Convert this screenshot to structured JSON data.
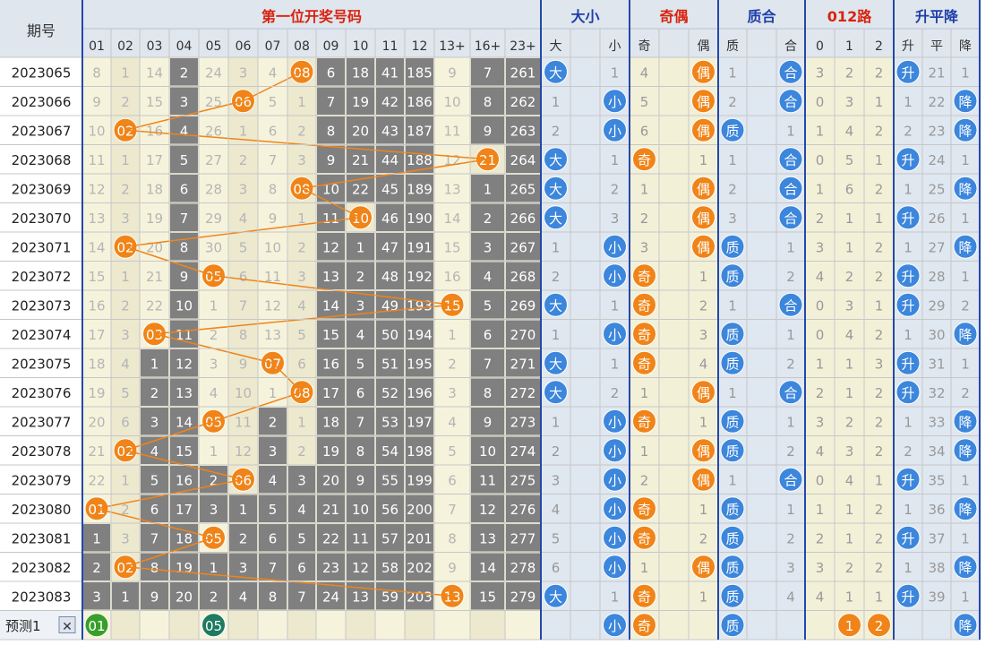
{
  "chart_data": {
    "type": "table",
    "header": {
      "period": "期号",
      "groups": [
        "第一位开奖号码",
        "大小",
        "奇偶",
        "质合",
        "012路",
        "升平降"
      ],
      "number_cols": [
        "01",
        "02",
        "03",
        "04",
        "05",
        "06",
        "07",
        "08",
        "09",
        "10",
        "11",
        "12",
        "13+",
        "16+",
        "23+"
      ],
      "bigsmall_cols": [
        "大",
        "小"
      ],
      "oddeven_cols": [
        "奇",
        "偶"
      ],
      "primecomp_cols": [
        "质",
        "合"
      ],
      "road_cols": [
        "0",
        "1",
        "2"
      ],
      "trend_cols": [
        "升",
        "平",
        "降"
      ]
    },
    "rows": [
      {
        "period": "2023065",
        "miss": [
          "8",
          "1",
          "14",
          "2",
          "24",
          "3",
          "4",
          "08",
          "6",
          "18",
          "41",
          "185",
          "9",
          "7",
          "261"
        ],
        "hit": 7,
        "bs": [
          "大",
          "1"
        ],
        "oe": [
          "4",
          "偶"
        ],
        "pc": [
          "1",
          "合"
        ],
        "road": [
          "3",
          "2",
          "2"
        ],
        "trend": [
          "升",
          "21",
          "1"
        ]
      },
      {
        "period": "2023066",
        "miss": [
          "9",
          "2",
          "15",
          "3",
          "25",
          "06",
          "5",
          "1",
          "7",
          "19",
          "42",
          "186",
          "10",
          "8",
          "262"
        ],
        "hit": 5,
        "bs": [
          "1",
          "小"
        ],
        "oe": [
          "5",
          "偶"
        ],
        "pc": [
          "2",
          "合"
        ],
        "road": [
          "0",
          "3",
          "1"
        ],
        "trend": [
          "1",
          "22",
          "降"
        ]
      },
      {
        "period": "2023067",
        "miss": [
          "10",
          "02",
          "16",
          "4",
          "26",
          "1",
          "6",
          "2",
          "8",
          "20",
          "43",
          "187",
          "11",
          "9",
          "263"
        ],
        "hit": 1,
        "bs": [
          "2",
          "小"
        ],
        "oe": [
          "6",
          "偶"
        ],
        "pc": [
          "质",
          "1"
        ],
        "road": [
          "1",
          "4",
          "2"
        ],
        "trend": [
          "2",
          "23",
          "降"
        ]
      },
      {
        "period": "2023068",
        "miss": [
          "11",
          "1",
          "17",
          "5",
          "27",
          "2",
          "7",
          "3",
          "9",
          "21",
          "44",
          "188",
          "12",
          "21",
          "264"
        ],
        "hit": 13,
        "bs": [
          "大",
          "1"
        ],
        "oe": [
          "奇",
          "1"
        ],
        "pc": [
          "1",
          "合"
        ],
        "road": [
          "0",
          "5",
          "1"
        ],
        "trend": [
          "升",
          "24",
          "1"
        ]
      },
      {
        "period": "2023069",
        "miss": [
          "12",
          "2",
          "18",
          "6",
          "28",
          "3",
          "8",
          "08",
          "10",
          "22",
          "45",
          "189",
          "13",
          "1",
          "265"
        ],
        "hit": 7,
        "bs": [
          "大",
          "2"
        ],
        "oe": [
          "1",
          "偶"
        ],
        "pc": [
          "2",
          "合"
        ],
        "road": [
          "1",
          "6",
          "2"
        ],
        "trend": [
          "1",
          "25",
          "降"
        ]
      },
      {
        "period": "2023070",
        "miss": [
          "13",
          "3",
          "19",
          "7",
          "29",
          "4",
          "9",
          "1",
          "11",
          "10",
          "46",
          "190",
          "14",
          "2",
          "266"
        ],
        "hit": 9,
        "bs": [
          "大",
          "3"
        ],
        "oe": [
          "2",
          "偶"
        ],
        "pc": [
          "3",
          "合"
        ],
        "road": [
          "2",
          "1",
          "1"
        ],
        "trend": [
          "升",
          "26",
          "1"
        ]
      },
      {
        "period": "2023071",
        "miss": [
          "14",
          "02",
          "20",
          "8",
          "30",
          "5",
          "10",
          "2",
          "12",
          "1",
          "47",
          "191",
          "15",
          "3",
          "267"
        ],
        "hit": 1,
        "bs": [
          "1",
          "小"
        ],
        "oe": [
          "3",
          "偶"
        ],
        "pc": [
          "质",
          "1"
        ],
        "road": [
          "3",
          "1",
          "2"
        ],
        "trend": [
          "1",
          "27",
          "降"
        ]
      },
      {
        "period": "2023072",
        "miss": [
          "15",
          "1",
          "21",
          "9",
          "05",
          "6",
          "11",
          "3",
          "13",
          "2",
          "48",
          "192",
          "16",
          "4",
          "268"
        ],
        "hit": 4,
        "bs": [
          "2",
          "小"
        ],
        "oe": [
          "奇",
          "1"
        ],
        "pc": [
          "质",
          "2"
        ],
        "road": [
          "4",
          "2",
          "2"
        ],
        "trend": [
          "升",
          "28",
          "1"
        ]
      },
      {
        "period": "2023073",
        "miss": [
          "16",
          "2",
          "22",
          "10",
          "1",
          "7",
          "12",
          "4",
          "14",
          "3",
          "49",
          "193",
          "15",
          "5",
          "269"
        ],
        "hit": 12,
        "bs": [
          "大",
          "1"
        ],
        "oe": [
          "奇",
          "2"
        ],
        "pc": [
          "1",
          "合"
        ],
        "road": [
          "0",
          "3",
          "1"
        ],
        "trend": [
          "升",
          "29",
          "2"
        ]
      },
      {
        "period": "2023074",
        "miss": [
          "17",
          "3",
          "03",
          "11",
          "2",
          "8",
          "13",
          "5",
          "15",
          "4",
          "50",
          "194",
          "1",
          "6",
          "270"
        ],
        "hit": 2,
        "bs": [
          "1",
          "小"
        ],
        "oe": [
          "奇",
          "3"
        ],
        "pc": [
          "质",
          "1"
        ],
        "road": [
          "0",
          "4",
          "2"
        ],
        "trend": [
          "1",
          "30",
          "降"
        ]
      },
      {
        "period": "2023075",
        "miss": [
          "18",
          "4",
          "1",
          "12",
          "3",
          "9",
          "07",
          "6",
          "16",
          "5",
          "51",
          "195",
          "2",
          "7",
          "271"
        ],
        "hit": 6,
        "bs": [
          "大",
          "1"
        ],
        "oe": [
          "奇",
          "4"
        ],
        "pc": [
          "质",
          "2"
        ],
        "road": [
          "1",
          "1",
          "3"
        ],
        "trend": [
          "升",
          "31",
          "1"
        ]
      },
      {
        "period": "2023076",
        "miss": [
          "19",
          "5",
          "2",
          "13",
          "4",
          "10",
          "1",
          "08",
          "17",
          "6",
          "52",
          "196",
          "3",
          "8",
          "272"
        ],
        "hit": 7,
        "bs": [
          "大",
          "2"
        ],
        "oe": [
          "1",
          "偶"
        ],
        "pc": [
          "1",
          "合"
        ],
        "road": [
          "2",
          "1",
          "2"
        ],
        "trend": [
          "升",
          "32",
          "2"
        ]
      },
      {
        "period": "2023077",
        "miss": [
          "20",
          "6",
          "3",
          "14",
          "05",
          "11",
          "2",
          "1",
          "18",
          "7",
          "53",
          "197",
          "4",
          "9",
          "273"
        ],
        "hit": 4,
        "bs": [
          "1",
          "小"
        ],
        "oe": [
          "奇",
          "1"
        ],
        "pc": [
          "质",
          "1"
        ],
        "road": [
          "3",
          "2",
          "2"
        ],
        "trend": [
          "1",
          "33",
          "降"
        ]
      },
      {
        "period": "2023078",
        "miss": [
          "21",
          "02",
          "4",
          "15",
          "1",
          "12",
          "3",
          "2",
          "19",
          "8",
          "54",
          "198",
          "5",
          "10",
          "274"
        ],
        "hit": 1,
        "bs": [
          "2",
          "小"
        ],
        "oe": [
          "1",
          "偶"
        ],
        "pc": [
          "质",
          "2"
        ],
        "road": [
          "4",
          "3",
          "2"
        ],
        "trend": [
          "2",
          "34",
          "降"
        ]
      },
      {
        "period": "2023079",
        "miss": [
          "22",
          "1",
          "5",
          "16",
          "2",
          "06",
          "4",
          "3",
          "20",
          "9",
          "55",
          "199",
          "6",
          "11",
          "275"
        ],
        "hit": 5,
        "bs": [
          "3",
          "小"
        ],
        "oe": [
          "2",
          "偶"
        ],
        "pc": [
          "1",
          "合"
        ],
        "road": [
          "0",
          "4",
          "1"
        ],
        "trend": [
          "升",
          "35",
          "1"
        ]
      },
      {
        "period": "2023080",
        "miss": [
          "01",
          "2",
          "6",
          "17",
          "3",
          "1",
          "5",
          "4",
          "21",
          "10",
          "56",
          "200",
          "7",
          "12",
          "276"
        ],
        "hit": 0,
        "bs": [
          "4",
          "小"
        ],
        "oe": [
          "奇",
          "1"
        ],
        "pc": [
          "质",
          "1"
        ],
        "road": [
          "1",
          "1",
          "2"
        ],
        "trend": [
          "1",
          "36",
          "降"
        ]
      },
      {
        "period": "2023081",
        "miss": [
          "1",
          "3",
          "7",
          "18",
          "05",
          "2",
          "6",
          "5",
          "22",
          "11",
          "57",
          "201",
          "8",
          "13",
          "277"
        ],
        "hit": 4,
        "bs": [
          "5",
          "小"
        ],
        "oe": [
          "奇",
          "2"
        ],
        "pc": [
          "质",
          "2"
        ],
        "road": [
          "2",
          "1",
          "2"
        ],
        "trend": [
          "升",
          "37",
          "1"
        ]
      },
      {
        "period": "2023082",
        "miss": [
          "2",
          "02",
          "8",
          "19",
          "1",
          "3",
          "7",
          "6",
          "23",
          "12",
          "58",
          "202",
          "9",
          "14",
          "278"
        ],
        "hit": 1,
        "bs": [
          "6",
          "小"
        ],
        "oe": [
          "1",
          "偶"
        ],
        "pc": [
          "质",
          "3"
        ],
        "road": [
          "3",
          "2",
          "2"
        ],
        "trend": [
          "1",
          "38",
          "降"
        ]
      },
      {
        "period": "2023083",
        "miss": [
          "3",
          "1",
          "9",
          "20",
          "2",
          "4",
          "8",
          "7",
          "24",
          "13",
          "59",
          "203",
          "13",
          "15",
          "279"
        ],
        "hit": 12,
        "bs": [
          "大",
          "1"
        ],
        "oe": [
          "奇",
          "1"
        ],
        "pc": [
          "质",
          "4"
        ],
        "road": [
          "4",
          "1",
          "1"
        ],
        "trend": [
          "升",
          "39",
          "1"
        ]
      }
    ],
    "forecast": {
      "label": "预测1",
      "close_mark": "✕",
      "numbers": [
        "01",
        "05"
      ],
      "bs": [
        "",
        "小"
      ],
      "oe": [
        "奇",
        ""
      ],
      "pc": [
        "质",
        ""
      ],
      "road": [
        "",
        "1",
        "2"
      ],
      "trend": [
        "",
        "",
        "降"
      ]
    },
    "colors": {
      "header_bg": "#dfe6ee",
      "red_title": "#d9230f",
      "blue_title": "#1f3fa8",
      "cream": "#f3f0d8",
      "grey_cell": "#c8c8c8",
      "dark_cell": "#808080",
      "orange_ball": "#f08418",
      "blue_ball": "#3c86dc",
      "green_ball": "#38a02a",
      "teal_ball": "#1e7a60",
      "line_orange": "#f08418",
      "line_blue": "#2f73c8"
    }
  }
}
